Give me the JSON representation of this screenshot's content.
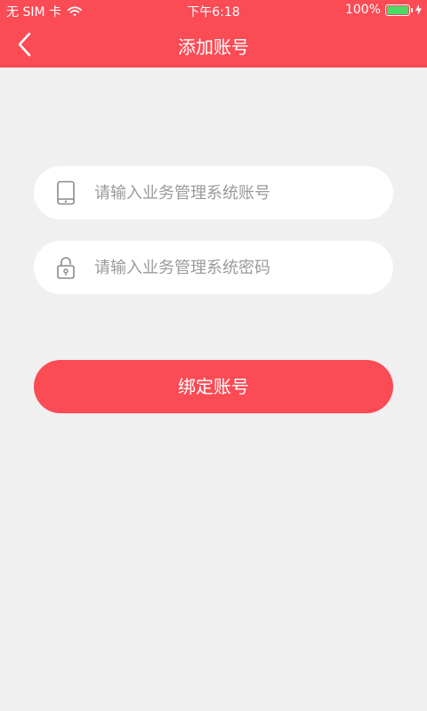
{
  "status_bar": {
    "carrier": "无 SIM 卡",
    "time": "下午6:18",
    "battery_percent": "100%",
    "battery_level": 1.0,
    "icons": [
      "wifi-icon",
      "battery-icon",
      "charging-icon"
    ]
  },
  "nav": {
    "title": "添加账号",
    "back_icon": "chevron-left-icon"
  },
  "form": {
    "account_field": {
      "icon": "tablet-icon",
      "placeholder": "请输入业务管理系统账号",
      "value": ""
    },
    "password_field": {
      "icon": "lock-icon",
      "placeholder": "请输入业务管理系统密码",
      "value": ""
    },
    "submit_label": "绑定账号"
  },
  "colors": {
    "accent": "#fb4b55",
    "background": "#f0f0f0",
    "field_background": "#ffffff",
    "placeholder": "#9a9a9a",
    "battery": "#4cd964"
  }
}
